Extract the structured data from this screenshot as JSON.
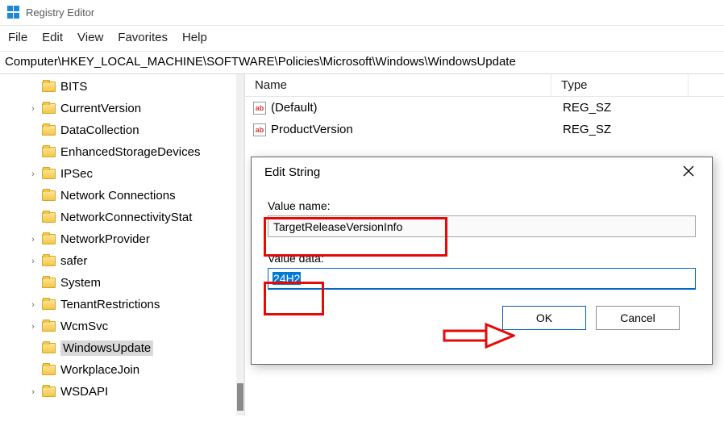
{
  "titlebar": {
    "title": "Registry Editor"
  },
  "menu": {
    "file": "File",
    "edit": "Edit",
    "view": "View",
    "favorites": "Favorites",
    "help": "Help"
  },
  "address": "Computer\\HKEY_LOCAL_MACHINE\\SOFTWARE\\Policies\\Microsoft\\Windows\\WindowsUpdate",
  "tree": {
    "items": [
      {
        "label": "BITS",
        "expandable": false
      },
      {
        "label": "CurrentVersion",
        "expandable": true
      },
      {
        "label": "DataCollection",
        "expandable": false
      },
      {
        "label": "EnhancedStorageDevices",
        "expandable": false
      },
      {
        "label": "IPSec",
        "expandable": true
      },
      {
        "label": "Network Connections",
        "expandable": false
      },
      {
        "label": "NetworkConnectivityStat",
        "expandable": false
      },
      {
        "label": "NetworkProvider",
        "expandable": true
      },
      {
        "label": "safer",
        "expandable": true
      },
      {
        "label": "System",
        "expandable": false
      },
      {
        "label": "TenantRestrictions",
        "expandable": true
      },
      {
        "label": "WcmSvc",
        "expandable": true
      },
      {
        "label": "WindowsUpdate",
        "expandable": false,
        "selected": true
      },
      {
        "label": "WorkplaceJoin",
        "expandable": false
      },
      {
        "label": "WSDAPI",
        "expandable": true
      }
    ]
  },
  "list": {
    "columns": {
      "name": "Name",
      "type": "Type"
    },
    "rows": [
      {
        "icon": "ab",
        "name": "(Default)",
        "type": "REG_SZ"
      },
      {
        "icon": "ab",
        "name": "ProductVersion",
        "type": "REG_SZ"
      }
    ]
  },
  "dialog": {
    "title": "Edit String",
    "valueNameLabel": "Value name:",
    "valueName": "TargetReleaseVersionInfo",
    "valueDataLabel": "Value data:",
    "valueData": "24H2",
    "ok": "OK",
    "cancel": "Cancel"
  }
}
